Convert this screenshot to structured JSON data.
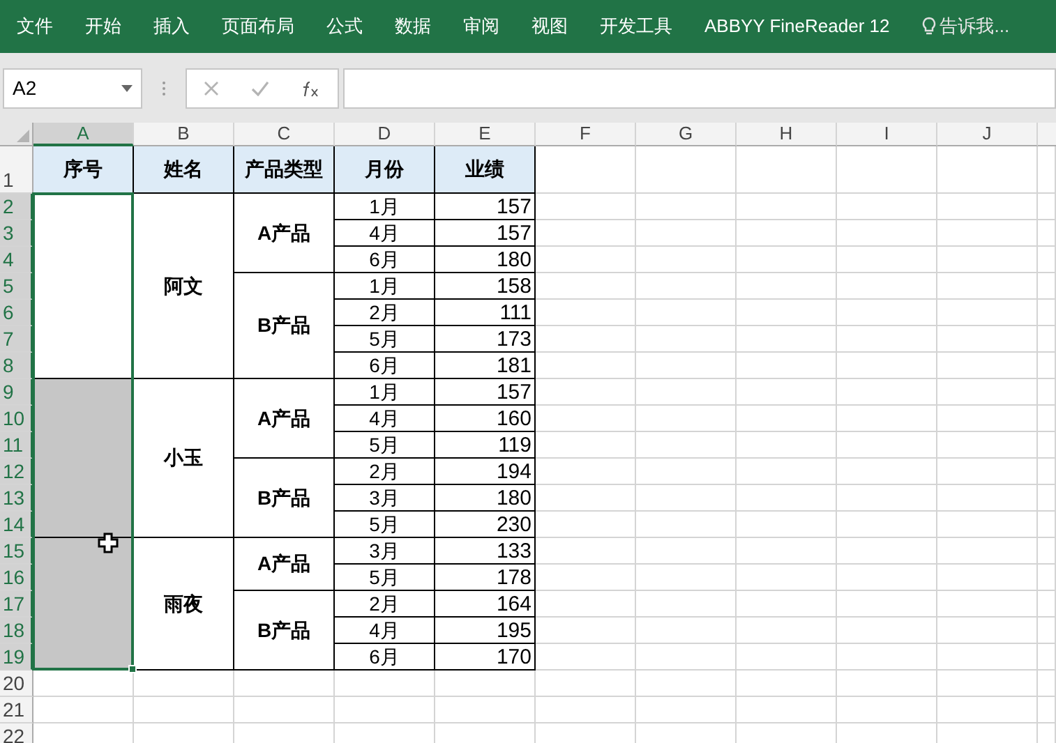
{
  "ribbon_tabs": [
    "文件",
    "开始",
    "插入",
    "页面布局",
    "公式",
    "数据",
    "审阅",
    "视图",
    "开发工具",
    "ABBYY FineReader 12"
  ],
  "tell_me": "告诉我...",
  "name_box": "A2",
  "column_headers": [
    {
      "label": "A",
      "selected": true
    },
    {
      "label": "B",
      "selected": false
    },
    {
      "label": "C",
      "selected": false
    },
    {
      "label": "D",
      "selected": false
    },
    {
      "label": "E",
      "selected": false
    },
    {
      "label": "F",
      "selected": false
    },
    {
      "label": "G",
      "selected": false
    },
    {
      "label": "H",
      "selected": false
    },
    {
      "label": "I",
      "selected": false
    },
    {
      "label": "J",
      "selected": false
    }
  ],
  "row_headers": [
    {
      "label": "1",
      "selected": false
    },
    {
      "label": "2",
      "selected": true
    },
    {
      "label": "3",
      "selected": true
    },
    {
      "label": "4",
      "selected": true
    },
    {
      "label": "5",
      "selected": true
    },
    {
      "label": "6",
      "selected": true
    },
    {
      "label": "7",
      "selected": true
    },
    {
      "label": "8",
      "selected": true
    },
    {
      "label": "9",
      "selected": true
    },
    {
      "label": "10",
      "selected": true
    },
    {
      "label": "11",
      "selected": true
    },
    {
      "label": "12",
      "selected": true
    },
    {
      "label": "13",
      "selected": true
    },
    {
      "label": "14",
      "selected": true
    },
    {
      "label": "15",
      "selected": true
    },
    {
      "label": "16",
      "selected": true
    },
    {
      "label": "17",
      "selected": true
    },
    {
      "label": "18",
      "selected": true
    },
    {
      "label": "19",
      "selected": true
    },
    {
      "label": "20",
      "selected": false
    },
    {
      "label": "21",
      "selected": false
    },
    {
      "label": "22",
      "selected": false
    }
  ],
  "table_header": [
    "序号",
    "姓名",
    "产品类型",
    "月份",
    "业绩"
  ],
  "people": [
    {
      "name": "阿文",
      "seq_shaded": false,
      "products": [
        {
          "type": "A产品",
          "rows": [
            {
              "month": "1月",
              "value": "157"
            },
            {
              "month": "4月",
              "value": "157"
            },
            {
              "month": "6月",
              "value": "180"
            }
          ]
        },
        {
          "type": "B产品",
          "rows": [
            {
              "month": "1月",
              "value": "158"
            },
            {
              "month": "2月",
              "value": "111"
            },
            {
              "month": "5月",
              "value": "173"
            },
            {
              "month": "6月",
              "value": "181"
            }
          ]
        }
      ]
    },
    {
      "name": "小玉",
      "seq_shaded": true,
      "products": [
        {
          "type": "A产品",
          "rows": [
            {
              "month": "1月",
              "value": "157"
            },
            {
              "month": "4月",
              "value": "160"
            },
            {
              "month": "5月",
              "value": "119"
            }
          ]
        },
        {
          "type": "B产品",
          "rows": [
            {
              "month": "2月",
              "value": "194"
            },
            {
              "month": "3月",
              "value": "180"
            },
            {
              "month": "5月",
              "value": "230"
            }
          ]
        }
      ]
    },
    {
      "name": "雨夜",
      "seq_shaded": true,
      "products": [
        {
          "type": "A产品",
          "rows": [
            {
              "month": "3月",
              "value": "133"
            },
            {
              "month": "5月",
              "value": "178"
            }
          ]
        },
        {
          "type": "B产品",
          "rows": [
            {
              "month": "2月",
              "value": "164"
            },
            {
              "month": "4月",
              "value": "195"
            },
            {
              "month": "6月",
              "value": "170"
            }
          ]
        }
      ]
    }
  ]
}
